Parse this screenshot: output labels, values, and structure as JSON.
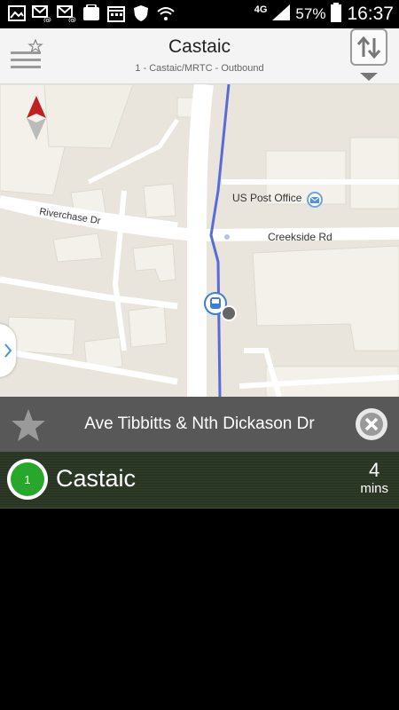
{
  "status_bar": {
    "network": "4G",
    "battery_percent": "57%",
    "time": "16:37",
    "left_icons": [
      "gallery-icon",
      "email-icon",
      "email-icon",
      "galaxy-store-icon",
      "calendar-icon",
      "shield-icon",
      "wifi-icon"
    ]
  },
  "header": {
    "title": "Castaic",
    "subtitle": "1 - Castaic/MRTC - Outbound"
  },
  "map": {
    "labels": {
      "post_office": "US Post Office",
      "riverchase": "Riverchase Dr",
      "creekside": "Creekside Rd"
    },
    "route_color": "#5b6bd6"
  },
  "stop": {
    "name": "Ave Tibbitts & Nth Dickason Dr"
  },
  "arrival": {
    "route_number": "1",
    "destination": "Castaic",
    "minutes": "4",
    "unit": "mins",
    "route_color": "#27a82b"
  }
}
